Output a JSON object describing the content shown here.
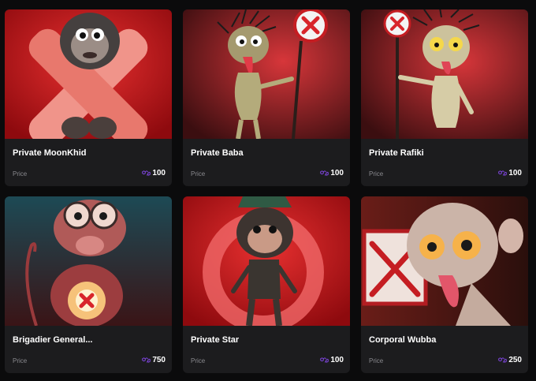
{
  "cards": [
    {
      "name": "Private MoonKhid",
      "price_label": "Price",
      "price": "100",
      "currency_icon": "polygon-icon"
    },
    {
      "name": "Private Baba",
      "price_label": "Price",
      "price": "100",
      "currency_icon": "polygon-icon"
    },
    {
      "name": "Private Rafiki",
      "price_label": "Price",
      "price": "100",
      "currency_icon": "polygon-icon"
    },
    {
      "name": "Brigadier General...",
      "price_label": "Price",
      "price": "750",
      "currency_icon": "polygon-icon"
    },
    {
      "name": "Private Star",
      "price_label": "Price",
      "price": "100",
      "currency_icon": "polygon-icon"
    },
    {
      "name": "Corporal Wubba",
      "price_label": "Price",
      "price": "250",
      "currency_icon": "polygon-icon"
    }
  ],
  "colors": {
    "page_background": "#0b0b0c",
    "card_background": "#1c1c1e",
    "accent_polygon": "#8247e5",
    "artwork_red": "#c8161c"
  }
}
